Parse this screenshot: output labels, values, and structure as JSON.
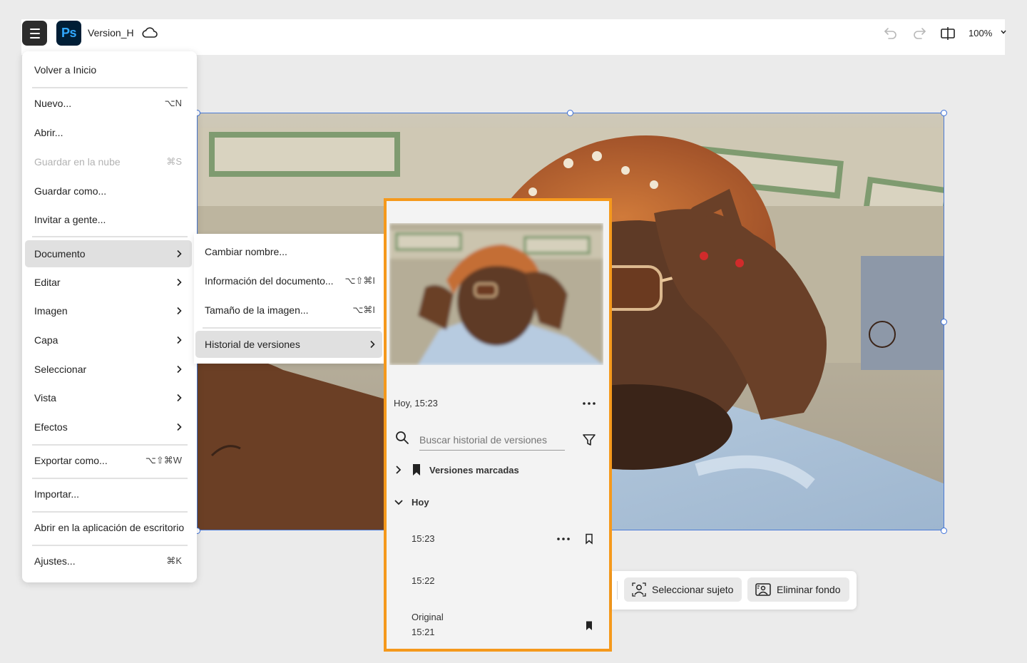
{
  "header": {
    "menu_icon": "hamburger-icon",
    "app_logo_text": "Ps",
    "document_title": "Version_H",
    "cloud_icon": "cloud-icon",
    "zoom_level": "100%"
  },
  "main_menu": {
    "items": [
      {
        "label": "Volver a Inicio",
        "shortcut": ""
      },
      {
        "label": "Nuevo...",
        "shortcut": "⌥N"
      },
      {
        "label": "Abrir...",
        "shortcut": ""
      },
      {
        "label": "Guardar en la nube",
        "shortcut": "⌘S",
        "disabled": true
      },
      {
        "label": "Guardar como...",
        "shortcut": ""
      },
      {
        "label": "Invitar a gente...",
        "shortcut": ""
      },
      {
        "label": "Documento",
        "submenu": true,
        "active": true
      },
      {
        "label": "Editar",
        "submenu": true
      },
      {
        "label": "Imagen",
        "submenu": true
      },
      {
        "label": "Capa",
        "submenu": true
      },
      {
        "label": "Seleccionar",
        "submenu": true
      },
      {
        "label": "Vista",
        "submenu": true
      },
      {
        "label": "Efectos",
        "submenu": true
      },
      {
        "label": "Exportar como...",
        "shortcut": "⌥⇧⌘W"
      },
      {
        "label": "Importar...",
        "shortcut": ""
      },
      {
        "label": "Abrir en la aplicación de escritorio",
        "shortcut": ""
      },
      {
        "label": "Ajustes...",
        "shortcut": "⌘K"
      }
    ]
  },
  "document_submenu": {
    "items": [
      {
        "label": "Cambiar nombre...",
        "shortcut": ""
      },
      {
        "label": "Información del documento...",
        "shortcut": "⌥⇧⌘I"
      },
      {
        "label": "Tamaño de la imagen...",
        "shortcut": "⌥⌘I"
      },
      {
        "label": "Historial de versiones",
        "submenu": true,
        "active": true
      }
    ]
  },
  "version_panel": {
    "current_date": "Hoy, 15:23",
    "search_placeholder": "Buscar historial de versiones",
    "bookmarked_label": "Versiones marcadas",
    "today_label": "Hoy",
    "versions": [
      {
        "time": "15:23",
        "bookmarked": false
      },
      {
        "time": "15:22",
        "bookmarked": false
      },
      {
        "label": "Original",
        "time": "15:21",
        "bookmarked": true
      }
    ],
    "highlight_color": "#f5991c"
  },
  "taskbar": {
    "select_subject": "Seleccionar sujeto",
    "remove_background": "Eliminar fondo"
  }
}
